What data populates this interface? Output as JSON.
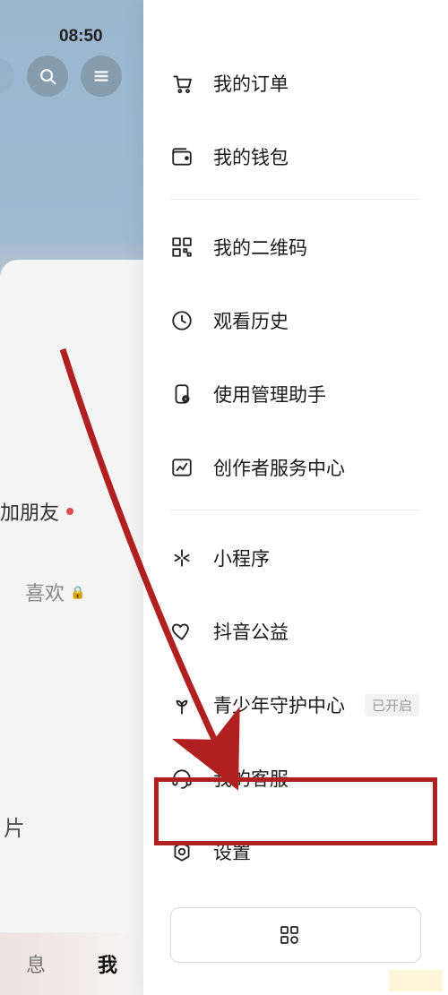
{
  "status": {
    "time": "08:50"
  },
  "left": {
    "add_friend": "加朋友",
    "like": "喜欢",
    "pian": "片",
    "tab_msg": "息",
    "tab_me": "我"
  },
  "drawer": {
    "items": [
      {
        "id": "orders",
        "label": "我的订单",
        "icon": "cart"
      },
      {
        "id": "wallet",
        "label": "我的钱包",
        "icon": "wallet"
      },
      {
        "sep": true
      },
      {
        "id": "qrcode",
        "label": "我的二维码",
        "icon": "qr"
      },
      {
        "id": "history",
        "label": "观看历史",
        "icon": "clock"
      },
      {
        "id": "usage",
        "label": "使用管理助手",
        "icon": "phone-setting"
      },
      {
        "id": "creator",
        "label": "创作者服务中心",
        "icon": "chart"
      },
      {
        "sep": true
      },
      {
        "id": "miniapp",
        "label": "小程序",
        "icon": "spark"
      },
      {
        "id": "welfare",
        "label": "抖音公益",
        "icon": "heart"
      },
      {
        "id": "teen",
        "label": "青少年守护中心",
        "icon": "sprout",
        "badge": "已开启"
      },
      {
        "id": "support",
        "label": "我的客服",
        "icon": "headset"
      },
      {
        "id": "settings",
        "label": "设置",
        "icon": "gear"
      }
    ],
    "bottom_button": {
      "label": "",
      "icon": "grid"
    }
  },
  "annotation": {
    "highlight_item_id": "settings"
  }
}
